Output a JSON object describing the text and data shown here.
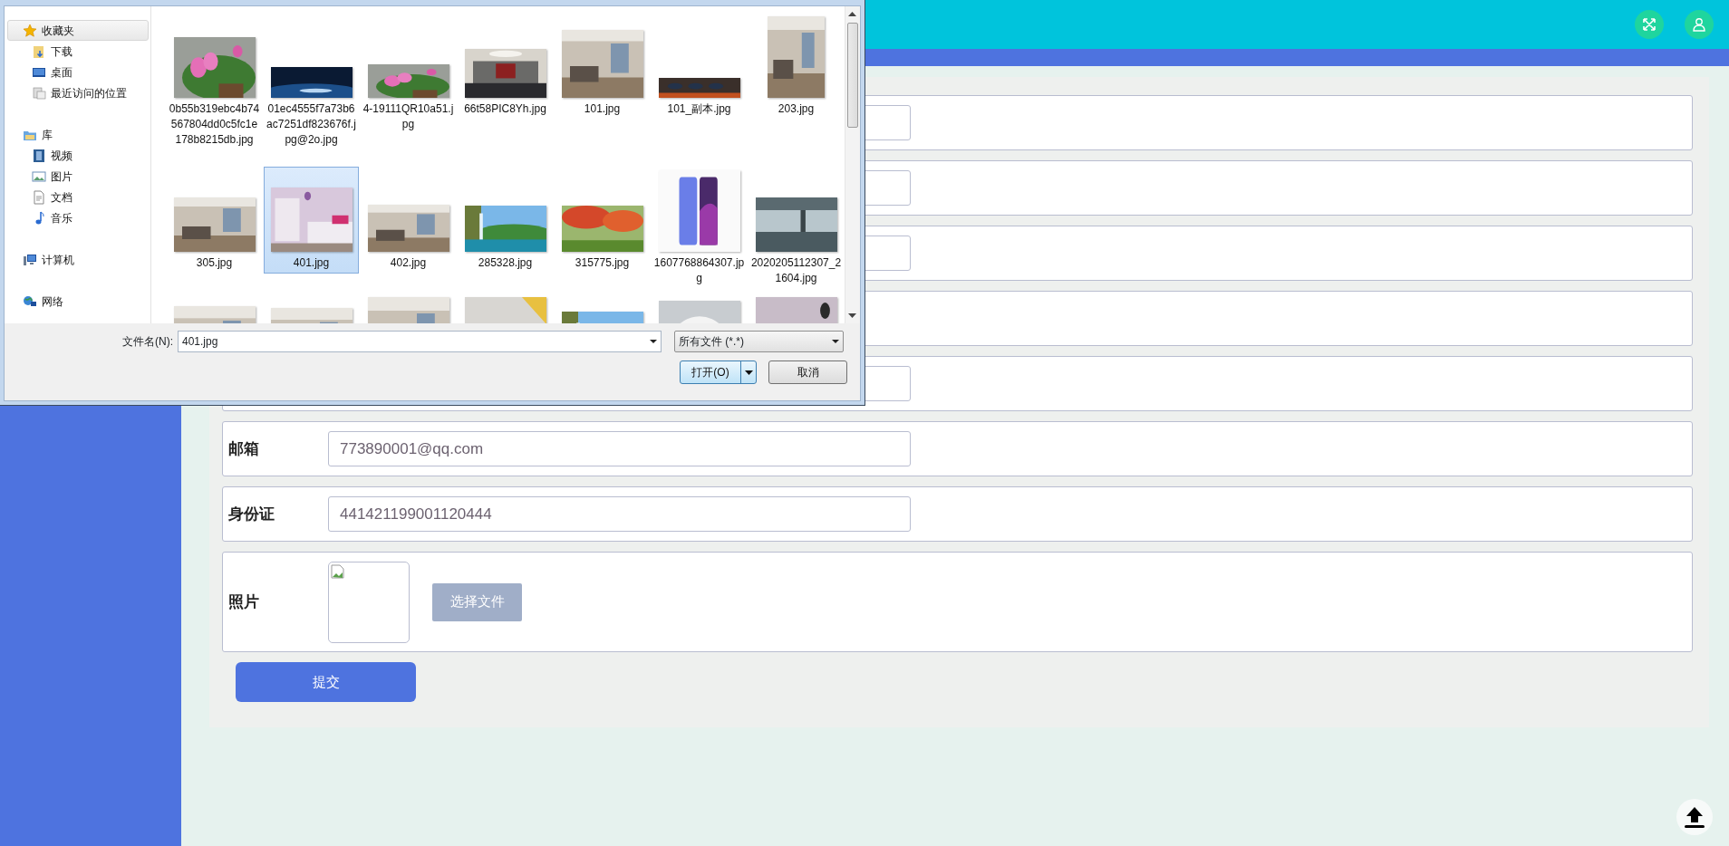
{
  "dialog": {
    "nav": [
      {
        "label": "收藏夹",
        "kind": "favorites",
        "selected": true,
        "children": [
          {
            "label": "下载",
            "kind": "downloads",
            "selected": false
          },
          {
            "label": "桌面",
            "kind": "desktop",
            "selected": false
          },
          {
            "label": "最近访问的位置",
            "kind": "recent",
            "selected": false
          }
        ]
      },
      {
        "label": "库",
        "kind": "library",
        "selected": false,
        "children": [
          {
            "label": "视频",
            "kind": "videos",
            "selected": false
          },
          {
            "label": "图片",
            "kind": "pictures",
            "selected": false
          },
          {
            "label": "文档",
            "kind": "documents",
            "selected": false
          },
          {
            "label": "音乐",
            "kind": "music",
            "selected": false
          }
        ]
      },
      {
        "label": "计算机",
        "kind": "computer",
        "selected": false
      },
      {
        "label": "网络",
        "kind": "network",
        "selected": false
      }
    ],
    "files": [
      {
        "name": "0b55b319ebc4b74567804dd0c5fc1e178b8215db.jpg",
        "selected": false
      },
      {
        "name": "01ec4555f7a73b6ac7251df823676f.jpg@2o.jpg",
        "selected": false
      },
      {
        "name": "4-19111QR10a51.jpg",
        "selected": false
      },
      {
        "name": "66t58PIC8Yh.jpg",
        "selected": false
      },
      {
        "name": "101.jpg",
        "selected": false
      },
      {
        "name": "101_副本.jpg",
        "selected": false
      },
      {
        "name": "203.jpg",
        "selected": false
      },
      {
        "name": "305.jpg",
        "selected": false
      },
      {
        "name": "401.jpg",
        "selected": true
      },
      {
        "name": "402.jpg",
        "selected": false
      },
      {
        "name": "285328.jpg",
        "selected": false
      },
      {
        "name": "315775.jpg",
        "selected": false
      },
      {
        "name": "1607768864307.jpg",
        "selected": false
      },
      {
        "name": "2020205112307_21604.jpg",
        "selected": false
      },
      {
        "selected": false
      },
      {
        "selected": false
      },
      {
        "selected": false
      },
      {
        "selected": false
      },
      {
        "selected": false
      },
      {
        "selected": false
      },
      {
        "selected": false
      }
    ],
    "filename_label": "文件名(N):",
    "filename": "401.jpg",
    "filter": "所有文件 (*.*)",
    "buttons": [
      {
        "label": "打开(O)",
        "kind": "split"
      },
      {
        "label": "取消",
        "kind": "plain"
      }
    ]
  },
  "form": {
    "rows": [
      {
        "kind": "text"
      },
      {
        "kind": "text"
      },
      {
        "kind": "text"
      },
      {
        "kind": "blank"
      },
      {
        "kind": "text"
      },
      {
        "kind": "text",
        "label": "邮箱",
        "value": "773890001@qq.com"
      },
      {
        "kind": "text",
        "label": "身份证",
        "value": "441421199001120444"
      },
      {
        "label": "照片",
        "button": "选择文件"
      }
    ],
    "submit": "提交"
  }
}
